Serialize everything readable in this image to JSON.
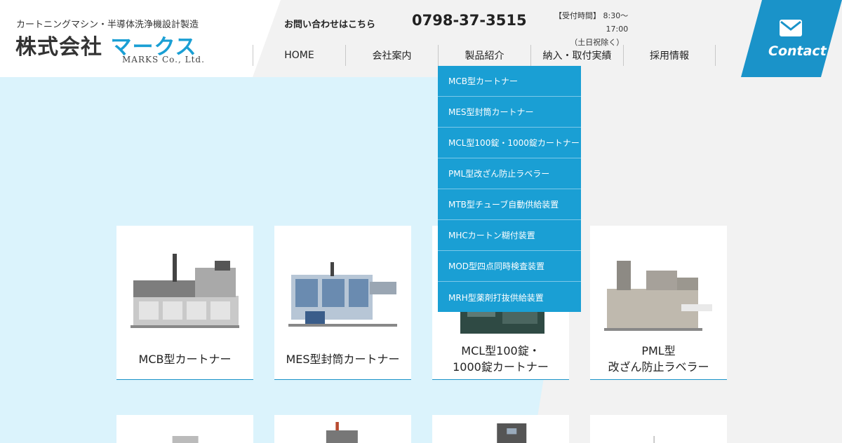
{
  "header": {
    "tagline": "カートニングマシン・半導体洗浄機設計製造",
    "logo_prefix": "株式会社",
    "logo_name": "マークス",
    "logo_en": "MARKS Co., Ltd.",
    "contact_label": "お問い合わせはこちら",
    "phone": "0798-37-3515",
    "hours_line1": "【受付時間】 8:30〜",
    "hours_line2": "17:00",
    "hours_line3": "（土日祝除く）",
    "contact_button": "Contact"
  },
  "nav": {
    "items": [
      {
        "label": "HOME"
      },
      {
        "label": "会社案内"
      },
      {
        "label": "製品紹介"
      },
      {
        "label": "納入・取付実績"
      },
      {
        "label": "採用情報"
      }
    ]
  },
  "dropdown": {
    "items": [
      {
        "label": "MCB型カートナー"
      },
      {
        "label": "MES型封筒カートナー"
      },
      {
        "label": "MCL型100錠・1000錠カートナー"
      },
      {
        "label": "PML型改ざん防止ラベラー"
      },
      {
        "label": "MTB型チューブ自動供給装置"
      },
      {
        "label": "MHCカートン糊付装置"
      },
      {
        "label": "MOD型四点同時検査装置"
      },
      {
        "label": "MRH型薬剤打抜供給装置"
      }
    ]
  },
  "products": [
    {
      "line1": "MCB型カートナー",
      "line2": ""
    },
    {
      "line1": "MES型封筒カートナー",
      "line2": ""
    },
    {
      "line1": "MCL型100錠・",
      "line2": "1000錠カートナー"
    },
    {
      "line1": "PML型",
      "line2": "改ざん防止ラベラー"
    }
  ],
  "colors": {
    "accent": "#1a9fd4",
    "accent_dark": "#1a93c9",
    "light_blue_bg": "#dbf3fc",
    "grey_bg": "#f2f2f2"
  },
  "icons": {
    "contact": "mail-icon"
  }
}
